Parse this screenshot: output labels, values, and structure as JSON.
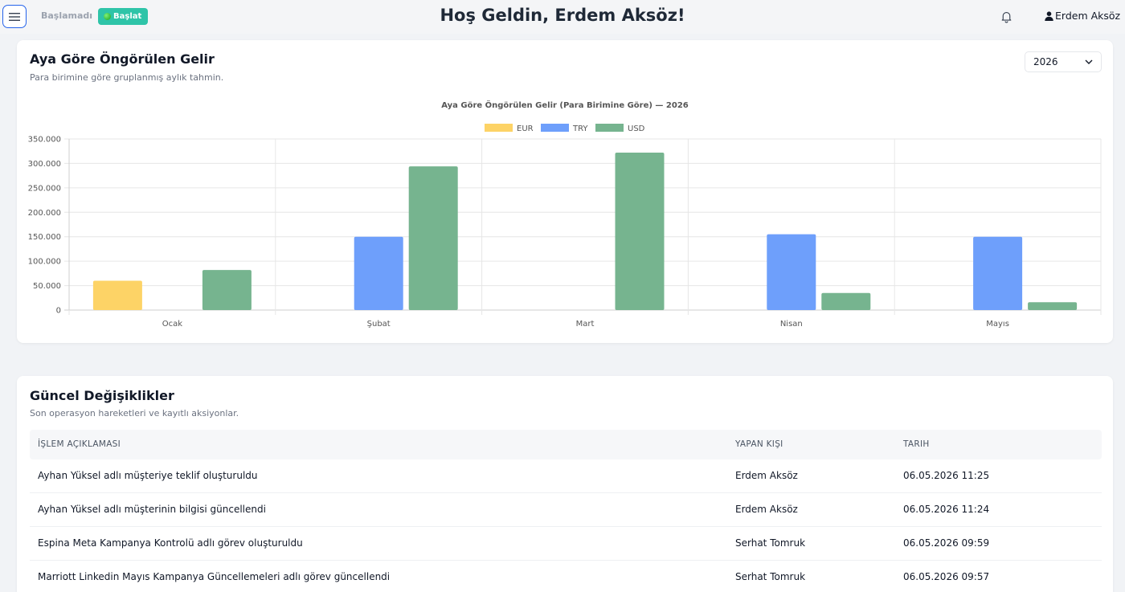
{
  "header": {
    "status_label": "Başlamadı",
    "start_button": "Başlat",
    "welcome": "Hoş Geldin, Erdem Aksöz!",
    "user_name": "Erdem Aksöz"
  },
  "revenue_card": {
    "title": "Aya Göre Öngörülen Gelir",
    "subtitle": "Para birimine göre gruplanmış aylık tahmin.",
    "year_selected": "2026"
  },
  "chart_data": {
    "type": "bar",
    "title": "Aya Göre Öngörülen Gelir (Para Birimine Göre) — 2026",
    "categories": [
      "Ocak",
      "Şubat",
      "Mart",
      "Nisan",
      "Mayıs"
    ],
    "series": [
      {
        "name": "EUR",
        "color": "#fdd366",
        "values": [
          60000,
          0,
          0,
          0,
          0
        ]
      },
      {
        "name": "TRY",
        "color": "#6e9ffb",
        "values": [
          0,
          150000,
          0,
          155000,
          150000
        ]
      },
      {
        "name": "USD",
        "color": "#76b48f",
        "values": [
          82000,
          294000,
          322000,
          35000,
          16000
        ]
      }
    ],
    "ylim": [
      0,
      350000
    ],
    "yticks": [
      "0",
      "50.000",
      "100.000",
      "150.000",
      "200.000",
      "250.000",
      "300.000",
      "350.000"
    ],
    "grid": true,
    "legend": "top-center"
  },
  "activity_card": {
    "title": "Güncel Değişiklikler",
    "subtitle": "Son operasyon hareketleri ve kayıtlı aksiyonlar.",
    "columns": [
      "İŞLEM AÇIKLAMASI",
      "YAPAN KIŞI",
      "TARIH"
    ],
    "rows": [
      [
        "Ayhan Yüksel adlı müşteriye teklif oluşturuldu",
        "Erdem Aksöz",
        "06.05.2026 11:25"
      ],
      [
        "Ayhan Yüksel adlı müşterinin bilgisi güncellendi",
        "Erdem Aksöz",
        "06.05.2026 11:24"
      ],
      [
        "Espina Meta Kampanya Kontrolü adlı görev oluşturuldu",
        "Serhat Tomruk",
        "06.05.2026 09:59"
      ],
      [
        "Marriott Linkedin Mayıs Kampanya Güncellemeleri adlı görev güncellendi",
        "Serhat Tomruk",
        "06.05.2026 09:57"
      ]
    ]
  },
  "icons": {
    "menu": "hamburger-menu-icon",
    "bell": "bell-icon",
    "user": "user-icon",
    "chevron": "chevron-down-icon"
  }
}
